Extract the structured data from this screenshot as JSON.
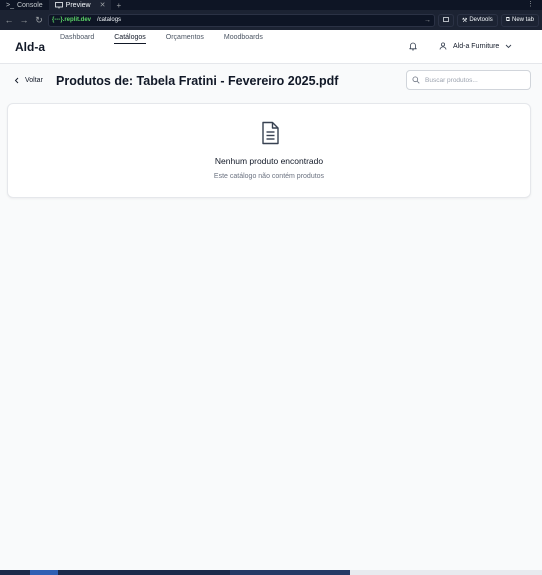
{
  "ide": {
    "tabs": [
      {
        "label": "Console",
        "icon": "terminal-icon"
      },
      {
        "label": "Preview",
        "icon": "monitor-icon",
        "active": true
      }
    ],
    "url_domain": "{---}.replit.dev",
    "url_path": "/catalogs",
    "devtools_label": "Devtools",
    "newtab_label": "New tab"
  },
  "header": {
    "logo": "Ald-a",
    "nav": [
      {
        "label": "Dashboard"
      },
      {
        "label": "Catálogos",
        "active": true
      },
      {
        "label": "Orçamentos"
      },
      {
        "label": "Moodboards"
      }
    ],
    "user_name": "Ald-a Furniture"
  },
  "page": {
    "back_label": "Voltar",
    "title": "Produtos de: Tabela Fratini - Fevereiro 2025.pdf",
    "search_placeholder": "Buscar produtos...",
    "search_value": ""
  },
  "empty_state": {
    "icon": "document-icon",
    "title": "Nenhum produto encontrado",
    "subtitle": "Este catálogo não contém produtos"
  },
  "colors": {
    "ide_bg": "#0e1525",
    "ide_bar": "#1c2333",
    "url_green": "#5bd466",
    "app_bg": "#f9fafb",
    "text": "#111827",
    "muted": "#6b7280"
  }
}
